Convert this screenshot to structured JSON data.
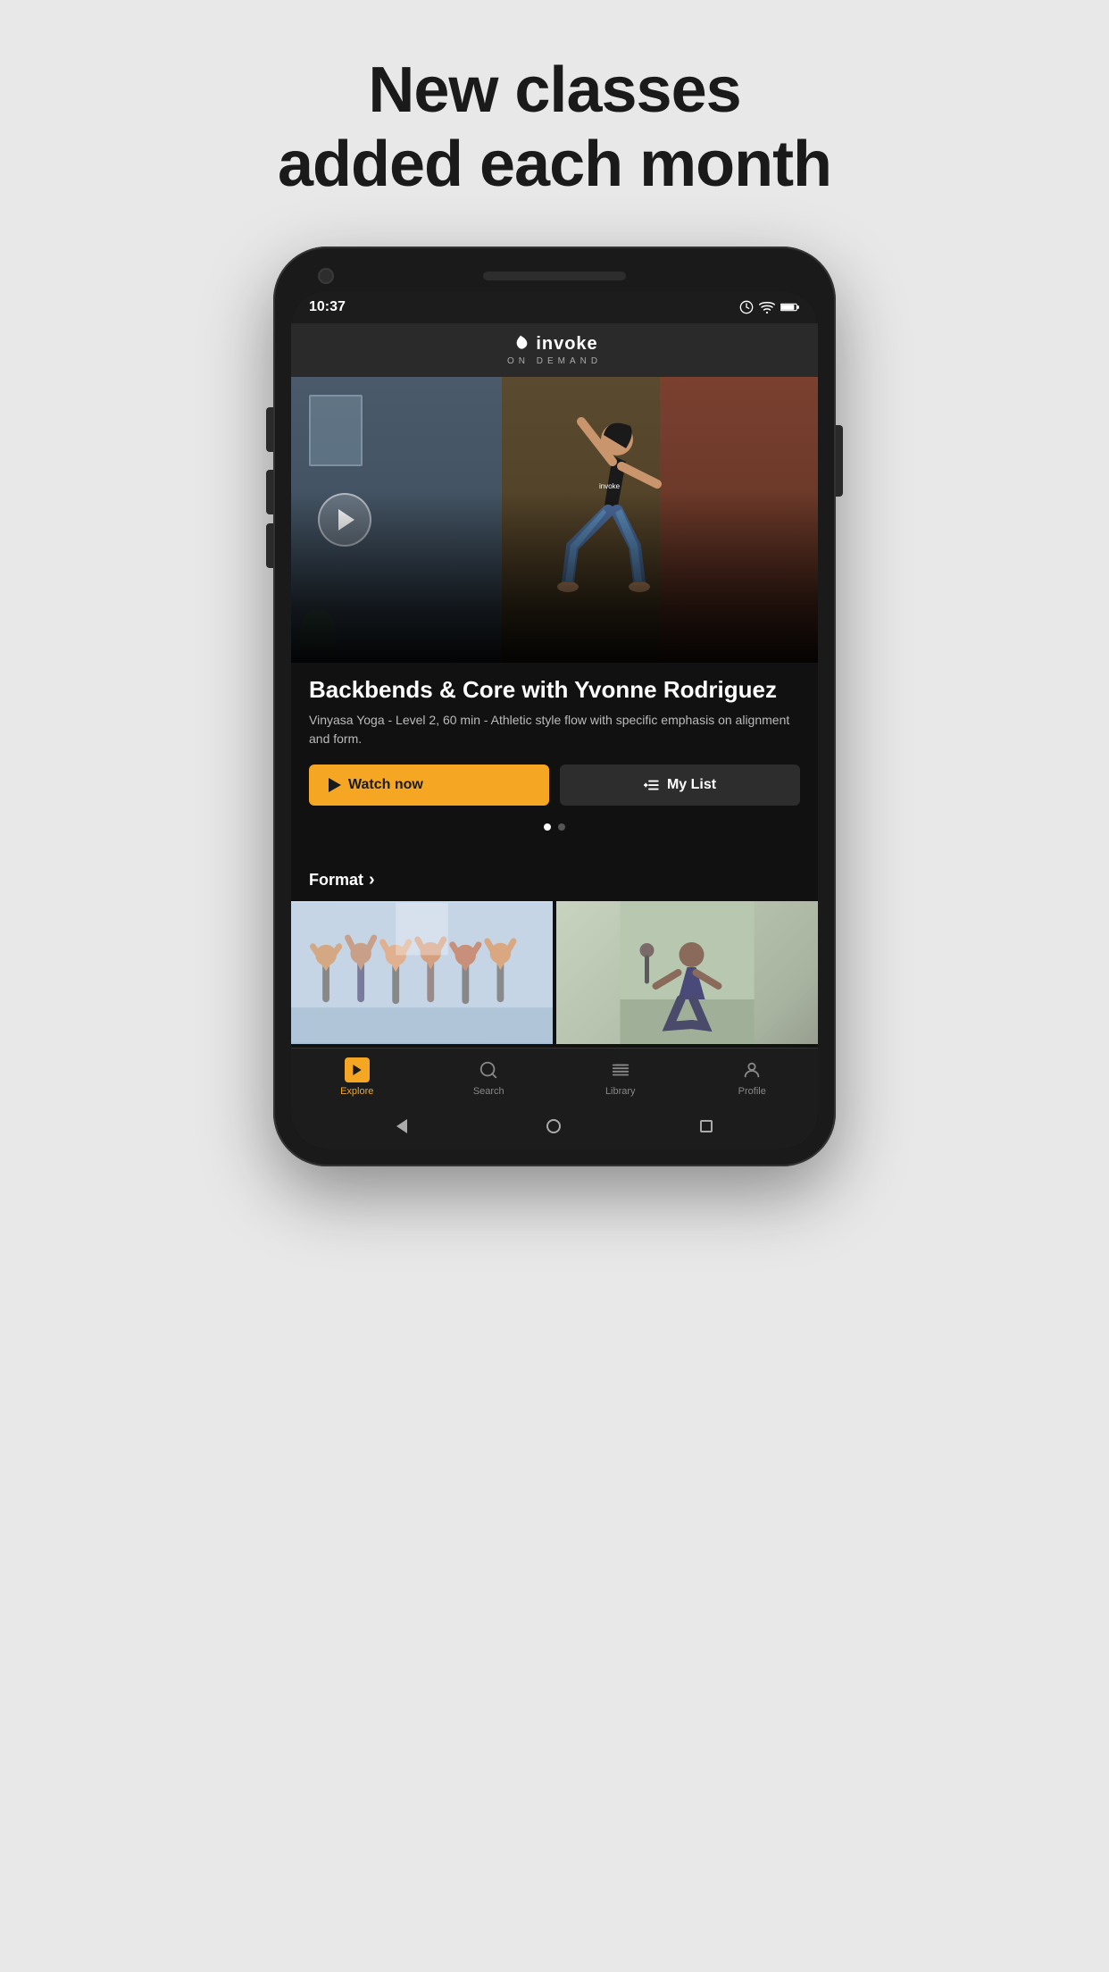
{
  "headline": {
    "line1": "New classes",
    "line2": "added each month"
  },
  "status_bar": {
    "time": "10:37",
    "wifi_icon": "wifi",
    "battery_icon": "battery"
  },
  "app_header": {
    "logo_symbol": "🌿",
    "logo_text": "invoke",
    "logo_sub": "ON DEMAND"
  },
  "hero": {
    "title": "Backbends & Core with Yvonne Rodriguez",
    "subtitle": "Vinyasa Yoga - Level 2, 60 min - Athletic style flow with specific emphasis on alignment and form.",
    "watch_now_label": "Watch now",
    "my_list_label": "My List",
    "dots": [
      true,
      false
    ]
  },
  "sections": {
    "format": {
      "title": "Format",
      "chevron": "›"
    }
  },
  "bottom_nav": {
    "items": [
      {
        "id": "explore",
        "label": "Explore",
        "active": true
      },
      {
        "id": "search",
        "label": "Search",
        "active": false
      },
      {
        "id": "library",
        "label": "Library",
        "active": false
      },
      {
        "id": "profile",
        "label": "Profile",
        "active": false
      }
    ]
  }
}
